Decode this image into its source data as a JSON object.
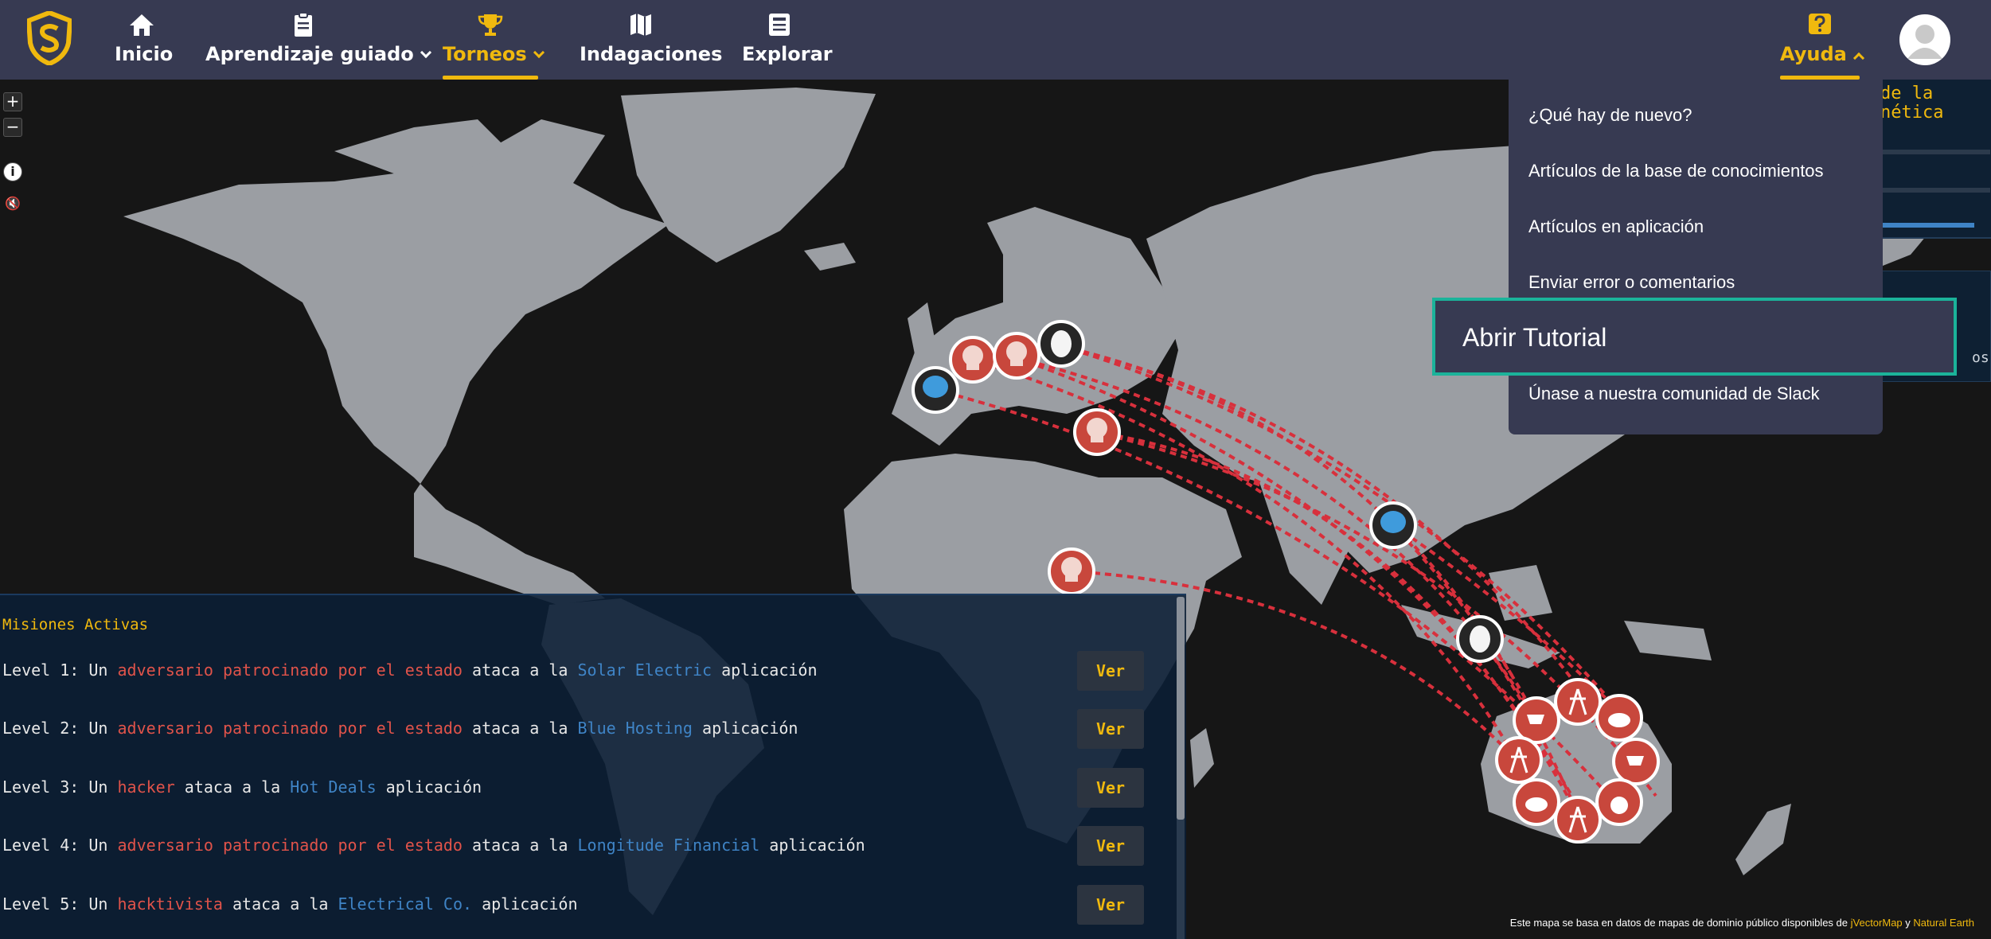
{
  "nav": {
    "logo": "shield-logo",
    "items": [
      {
        "label": "Inicio",
        "icon": "home-icon"
      },
      {
        "label": "Aprendizaje guiado",
        "icon": "clipboard-icon"
      },
      {
        "label": "Torneos",
        "icon": "trophy-icon"
      },
      {
        "label": "Indagaciones",
        "icon": "map-icon"
      },
      {
        "label": "Explorar",
        "icon": "newspaper-icon"
      }
    ],
    "help": {
      "label": "Ayuda",
      "icon": "question-icon"
    },
    "avatar": "user-avatar"
  },
  "help_menu": {
    "items": [
      "¿Qué hay de nuevo?",
      "Artículos de la base de conocimientos",
      "Artículos en aplicación",
      "Enviar error o comentarios",
      "Abrir Tutorial",
      "Únase a nuestra comunidad de Slack"
    ],
    "highlighted": "Abrir Tutorial"
  },
  "map_controls": {
    "zoom_in": "+",
    "zoom_out": "−",
    "info": "i",
    "mute": "🔇"
  },
  "right_panel": {
    "title": "de la\nnética",
    "snippet": "os"
  },
  "missions": {
    "title": "Misiones Activas",
    "button_label": "Ver",
    "rows": [
      {
        "prefix": "Level 1: Un ",
        "attacker": "adversario patrocinado por el estado",
        "mid": " ataca a la ",
        "target": "Solar Electric",
        "suffix": " aplicación"
      },
      {
        "prefix": "Level 2: Un ",
        "attacker": "adversario patrocinado por el estado",
        "mid": " ataca a la ",
        "target": "Blue Hosting",
        "suffix": " aplicación"
      },
      {
        "prefix": "Level 3: Un ",
        "attacker": "hacker",
        "mid": " ataca a la ",
        "target": "Hot Deals",
        "suffix": " aplicación"
      },
      {
        "prefix": "Level 4: Un ",
        "attacker": "adversario patrocinado por el estado",
        "mid": " ataca a la ",
        "target": "Longitude Financial",
        "suffix": " aplicación"
      },
      {
        "prefix": "Level 5: Un ",
        "attacker": "hacktivista",
        "mid": " ataca a la ",
        "target": "Electrical Co.",
        "suffix": " aplicación"
      }
    ]
  },
  "attribution": {
    "text": "Este mapa se basa en datos de mapas de dominio público disponibles de ",
    "link1": "jVectorMap",
    "and": " y ",
    "link2": "Natural Earth"
  },
  "colors": {
    "nav_bg": "#373a52",
    "accent": "#f0b90e",
    "land": "#9b9ea3",
    "ocean": "#161616",
    "attack_line": "#d8303c",
    "highlight_border": "#1bb39a"
  }
}
